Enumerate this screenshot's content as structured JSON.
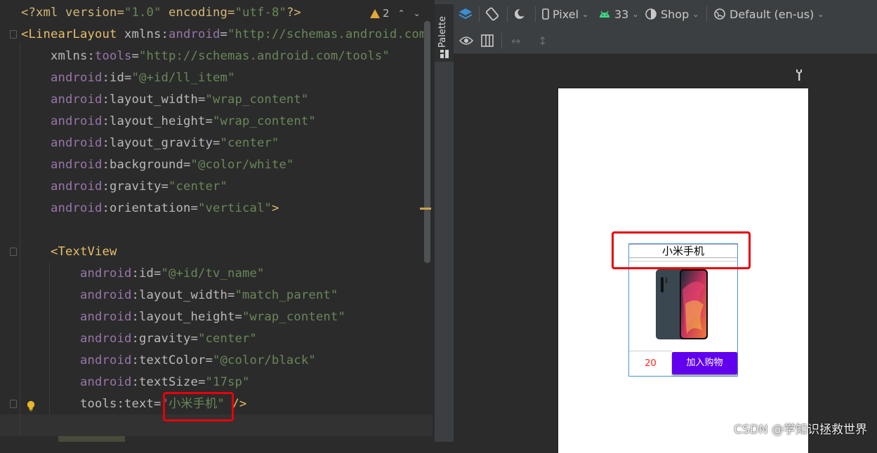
{
  "editor": {
    "warning_count": "2",
    "lines": [
      [
        {
          "c": "proc",
          "t": "<?xml version="
        },
        {
          "c": "str",
          "t": "\"1.0\""
        },
        {
          "c": "proc",
          "t": " encoding="
        },
        {
          "c": "str",
          "t": "\"utf-8\""
        },
        {
          "c": "proc",
          "t": "?>"
        }
      ],
      [
        {
          "c": "tag",
          "t": "<LinearLayout "
        },
        {
          "c": "attr",
          "t": "xmlns:"
        },
        {
          "c": "ns",
          "t": "android"
        },
        {
          "c": "attr",
          "t": "="
        },
        {
          "c": "str",
          "t": "\"http://schemas.android.com"
        }
      ],
      [
        {
          "c": "attr",
          "t": "    xmlns:"
        },
        {
          "c": "ns",
          "t": "tools"
        },
        {
          "c": "attr",
          "t": "="
        },
        {
          "c": "str",
          "t": "\"http://schemas.android.com/tools\""
        }
      ],
      [
        {
          "c": "ns",
          "t": "    android"
        },
        {
          "c": "attr",
          "t": ":id="
        },
        {
          "c": "str",
          "t": "\"@+id/ll_item\""
        }
      ],
      [
        {
          "c": "ns",
          "t": "    android"
        },
        {
          "c": "attr",
          "t": ":layout_width="
        },
        {
          "c": "str",
          "t": "\"wrap_content\""
        }
      ],
      [
        {
          "c": "ns",
          "t": "    android"
        },
        {
          "c": "attr",
          "t": ":layout_height="
        },
        {
          "c": "str",
          "t": "\"wrap_content\""
        }
      ],
      [
        {
          "c": "ns",
          "t": "    android"
        },
        {
          "c": "attr",
          "t": ":layout_gravity="
        },
        {
          "c": "str",
          "t": "\"center\""
        }
      ],
      [
        {
          "c": "ns",
          "t": "    android"
        },
        {
          "c": "attr",
          "t": ":background="
        },
        {
          "c": "str",
          "t": "\"@color/white\""
        }
      ],
      [
        {
          "c": "ns",
          "t": "    android"
        },
        {
          "c": "attr",
          "t": ":gravity="
        },
        {
          "c": "str",
          "t": "\"center\""
        }
      ],
      [
        {
          "c": "ns",
          "t": "    android"
        },
        {
          "c": "attr",
          "t": ":orientation="
        },
        {
          "c": "str",
          "t": "\"vertical\""
        },
        {
          "c": "tag",
          "t": ">"
        }
      ],
      [
        {
          "c": "plain",
          "t": ""
        }
      ],
      [
        {
          "c": "tag",
          "t": "    <TextView"
        }
      ],
      [
        {
          "c": "ns",
          "t": "        android"
        },
        {
          "c": "attr",
          "t": ":id="
        },
        {
          "c": "str",
          "t": "\"@+id/tv_name\""
        }
      ],
      [
        {
          "c": "ns",
          "t": "        android"
        },
        {
          "c": "attr",
          "t": ":layout_width="
        },
        {
          "c": "str",
          "t": "\"match_parent\""
        }
      ],
      [
        {
          "c": "ns",
          "t": "        android"
        },
        {
          "c": "attr",
          "t": ":layout_height="
        },
        {
          "c": "str",
          "t": "\"wrap_content\""
        }
      ],
      [
        {
          "c": "ns",
          "t": "        android"
        },
        {
          "c": "attr",
          "t": ":gravity="
        },
        {
          "c": "str",
          "t": "\"center\""
        }
      ],
      [
        {
          "c": "ns",
          "t": "        android"
        },
        {
          "c": "attr",
          "t": ":textColor="
        },
        {
          "c": "str",
          "t": "\"@color/black\""
        }
      ],
      [
        {
          "c": "ns",
          "t": "        android"
        },
        {
          "c": "attr",
          "t": ":textSize="
        },
        {
          "c": "str",
          "t": "\"17sp\""
        }
      ],
      [
        {
          "c": "attr",
          "t": "        tools:text="
        },
        {
          "c": "str",
          "t": "\"小米手机\""
        },
        {
          "c": "tag",
          "t": " />"
        }
      ]
    ]
  },
  "palette": {
    "label": "Palette"
  },
  "design_toolbar": {
    "device": "Pixel",
    "api_level": "33",
    "theme": "Shop",
    "locale": "Default (en-us)"
  },
  "preview": {
    "product_name": "小米手机",
    "price": "20",
    "add_to_cart": "加入购物"
  },
  "watermark": "CSDN @学知识拯救世界",
  "colors": {
    "accent_purple": "#6200ee",
    "highlight_red": "#e8000b",
    "price_red": "#ff2222"
  }
}
